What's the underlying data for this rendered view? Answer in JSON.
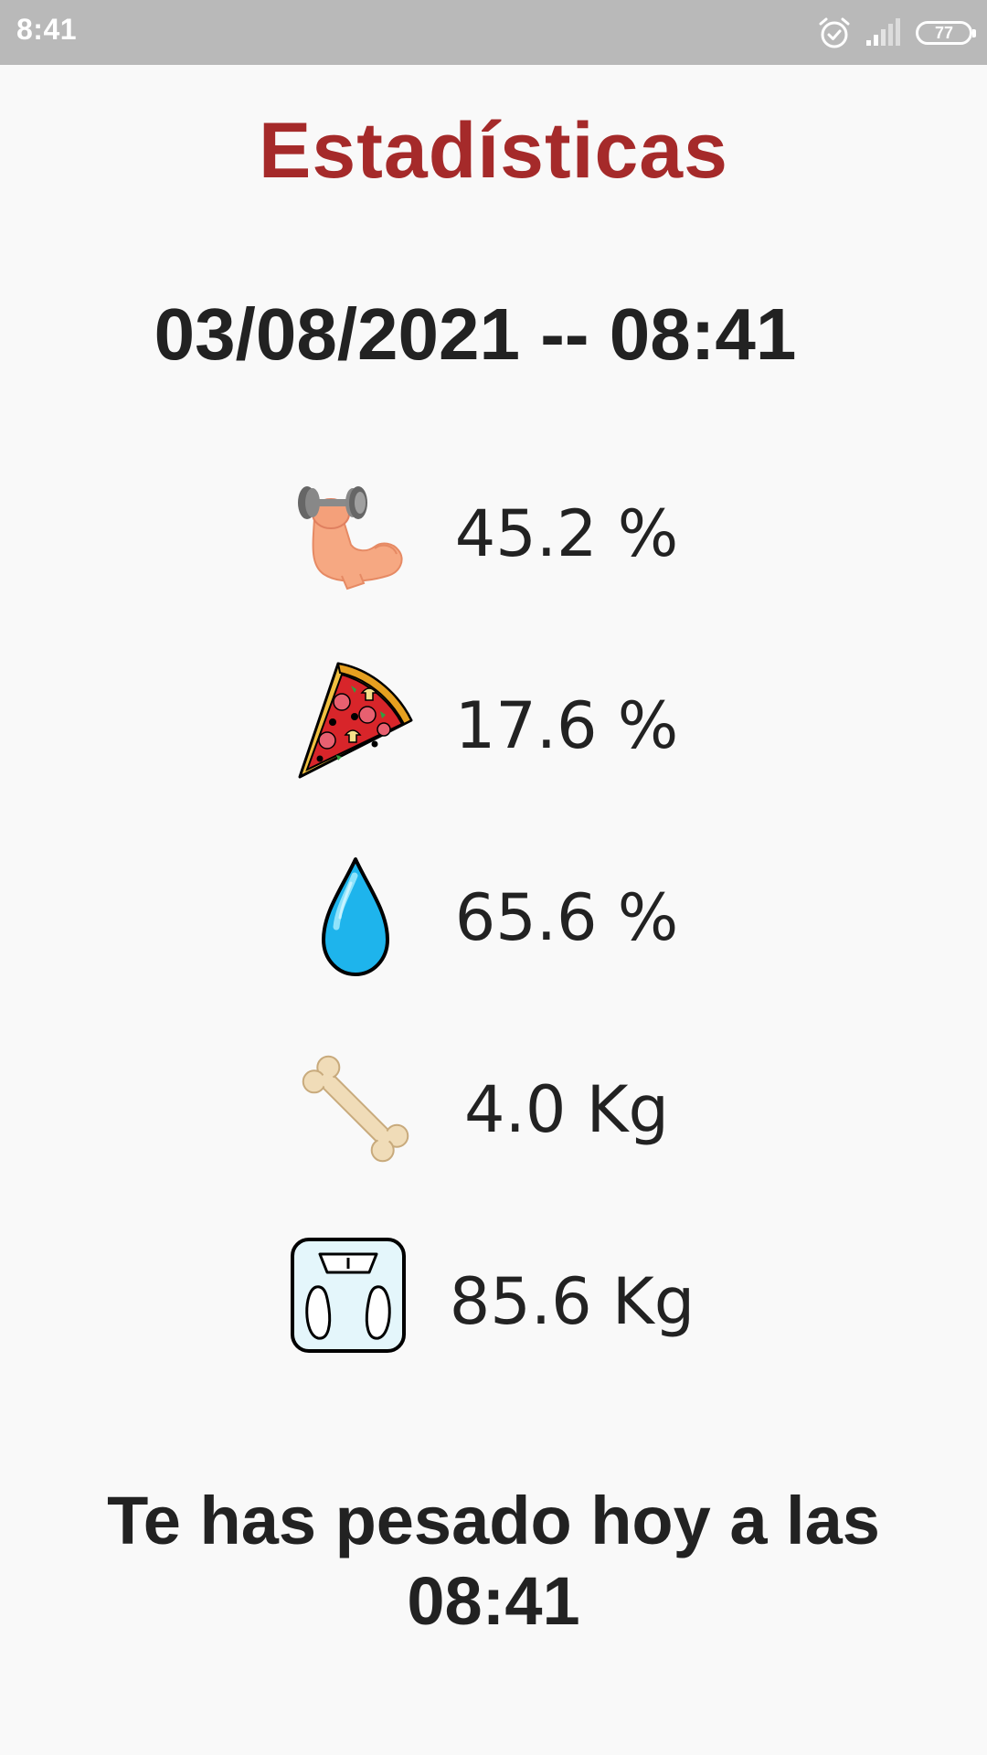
{
  "status_bar": {
    "time": "8:41",
    "battery": "77",
    "icons": [
      "alarm-icon",
      "signal-icon",
      "battery-icon"
    ]
  },
  "title": "Estadísticas",
  "datetime": "03/08/2021 -- 08:41",
  "stats": [
    {
      "icon": "muscle-icon",
      "value": "45.2 %"
    },
    {
      "icon": "pizza-icon",
      "value": "17.6 %"
    },
    {
      "icon": "water-drop-icon",
      "value": "65.6 %"
    },
    {
      "icon": "bone-icon",
      "value": "4.0 Kg"
    },
    {
      "icon": "scale-icon",
      "value": "85.6 Kg"
    }
  ],
  "footer": {
    "line1": "Te has pesado hoy a las",
    "line2": "08:41"
  },
  "colors": {
    "title": "#a52a2a",
    "status_bar": "#b9b9b9",
    "text": "#222222",
    "background": "#f9f9f9"
  }
}
